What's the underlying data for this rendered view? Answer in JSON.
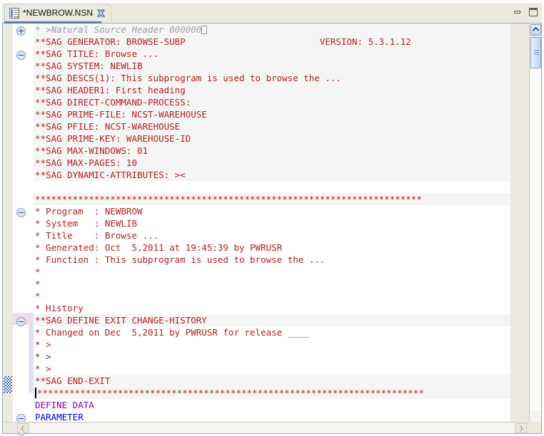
{
  "window": {
    "minimize_label": "Minimize",
    "maximize_label": "Restore"
  },
  "tab": {
    "title": "*NEWBROW.NSN",
    "icon": "natural-source-file-icon",
    "close_icon": "close-icon"
  },
  "editor": {
    "accent_color": "#5878b8",
    "comment_color": "#b42020",
    "keyword_color": "#0000cc",
    "define_color": "#8a00a8",
    "alt_line_color": "#f5f5f5",
    "lines": [
      {
        "text": "* >Natural Source Header 000000",
        "style": "italic",
        "fold": "plus",
        "alt": true,
        "trailing_box": true
      },
      {
        "text": "**SAG GENERATOR: BROWSE-SUBP                         VERSION: 5.3.1.12",
        "style": "red",
        "alt": true
      },
      {
        "text": "**SAG TITLE: Browse ...",
        "style": "red",
        "fold": "minus",
        "alt": true
      },
      {
        "text": "**SAG SYSTEM: NEWLIB",
        "style": "red",
        "alt": true
      },
      {
        "text": "**SAG DESCS(1): This subprogram is used to browse the ...",
        "style": "red",
        "alt": true
      },
      {
        "text": "**SAG HEADER1: First heading",
        "style": "red",
        "alt": true
      },
      {
        "text": "**SAG DIRECT-COMMAND-PROCESS:",
        "style": "red",
        "alt": true
      },
      {
        "text": "**SAG PRIME-FILE: NCST-WAREHOUSE",
        "style": "red",
        "alt": true
      },
      {
        "text": "**SAG PFILE: NCST-WAREHOUSE",
        "style": "red",
        "alt": true
      },
      {
        "text": "**SAG PRIME-KEY: WAREHOUSE-ID",
        "style": "red",
        "alt": true
      },
      {
        "text": "**SAG MAX-WINDOWS: 01",
        "style": "red",
        "alt": true
      },
      {
        "text": "**SAG MAX-PAGES: 10",
        "style": "red",
        "alt": true
      },
      {
        "text": "**SAG DYNAMIC-ATTRIBUTES: ><",
        "style": "red",
        "alt": true
      },
      {
        "text": "",
        "style": "red",
        "alt": false
      },
      {
        "text": "************************************************************************",
        "style": "red",
        "fold": "minus",
        "alt": true
      },
      {
        "text": "* Program  : NEWBROW",
        "style": "red",
        "alt": false
      },
      {
        "text": "* System   : NEWLIB",
        "style": "red",
        "alt": false
      },
      {
        "text": "* Title    : Browse ...",
        "style": "red",
        "alt": false
      },
      {
        "text": "* Generated: Oct  5,2011 at 19:45:39 by PWRUSR",
        "style": "red",
        "alt": false
      },
      {
        "text": "* Function : This subprogram is used to browse the ...",
        "style": "red",
        "alt": false
      },
      {
        "text": "*",
        "style": "red",
        "alt": false
      },
      {
        "text": "*",
        "style": "red",
        "alt": false
      },
      {
        "text": "*",
        "style": "red",
        "alt": false
      },
      {
        "text": "* History",
        "style": "red",
        "alt": false
      },
      {
        "text": "**SAG DEFINE EXIT CHANGE-HISTORY",
        "style": "red",
        "fold": "minus",
        "alt": true
      },
      {
        "text": "* Changed on Dec  5,2011 by PWRUSR for release ____",
        "style": "red",
        "alt": false
      },
      {
        "text": "* >",
        "style": "red",
        "alt": false
      },
      {
        "text": "* >",
        "style": "red",
        "alt": false
      },
      {
        "text": "* >",
        "style": "red",
        "alt": false
      },
      {
        "text": "**SAG END-EXIT",
        "style": "red",
        "alt": true
      },
      {
        "text": "************************************************************************",
        "style": "red",
        "alt": true,
        "caret": true
      },
      {
        "text": "DEFINE DATA",
        "style": "purple",
        "fold": "minus",
        "alt": false
      },
      {
        "text": "PARAMETER",
        "style": "blue",
        "fold": "minus",
        "alt": false
      }
    ]
  },
  "scrollbars": {
    "vertical": {
      "up_icon": "chevron-up-icon",
      "down_icon": "chevron-down-icon",
      "thumb_position_pct": 4
    },
    "horizontal": {
      "left_icon": "chevron-left-icon",
      "right_icon": "chevron-right-icon"
    }
  },
  "gutter": {
    "quickdiff_marker": "quick-diff-marker",
    "changed_marker": "changed-line-marker"
  }
}
